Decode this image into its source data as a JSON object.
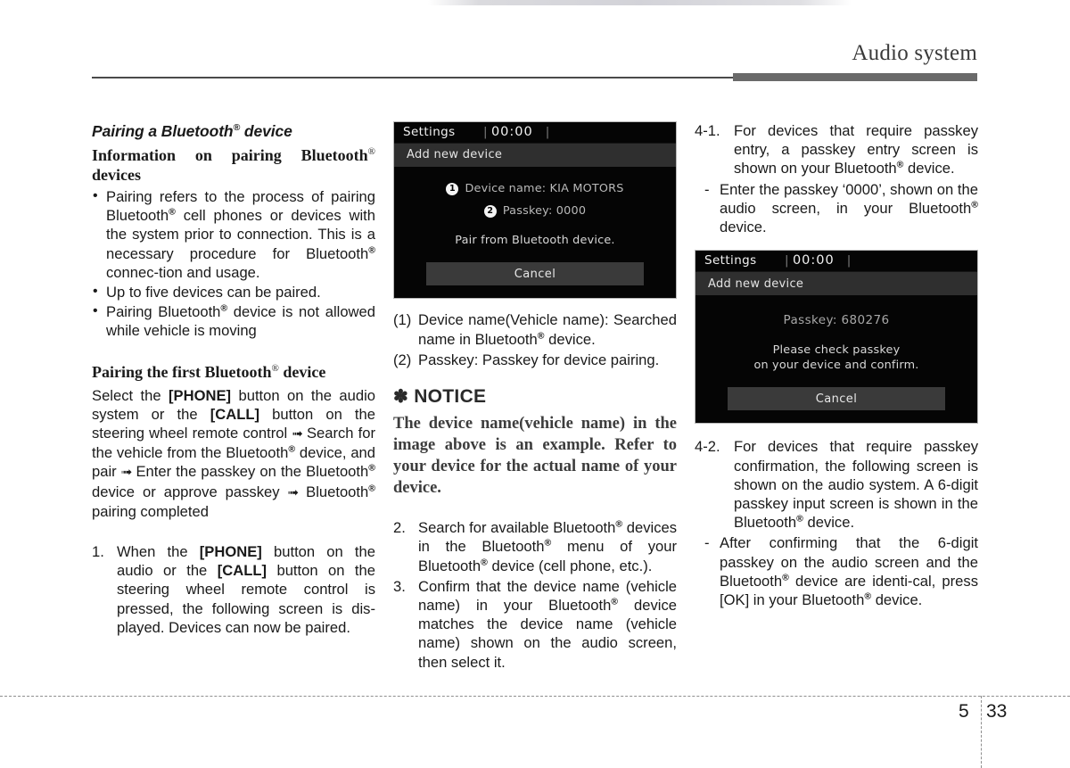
{
  "header": {
    "title": "Audio system"
  },
  "footer": {
    "chapter": "5",
    "page": "33"
  },
  "left_column": {
    "section_title": "Pairing a Bluetooth",
    "section_title_sup": "®",
    "section_title_tail": " device",
    "subhead_1": "Information on pairing Bluetooth",
    "subhead_1_sup": "®",
    "subhead_1_tail": "devices",
    "bullets": [
      {
        "parts": [
          {
            "t": "Pairing refers to the process of pairing Bluetooth"
          },
          {
            "t": "®",
            "sup": true
          },
          {
            "t": " cell phones or devices with the system prior to connection. This is a necessary procedure for Bluetooth"
          },
          {
            "t": "®",
            "sup": true
          },
          {
            "t": " connec-tion and usage."
          }
        ],
        "plain": "Pairing refers to the process of pairing Bluetooth® cell phones or devices with the system prior to connection. This is a necessary procedure for Bluetooth® connection and usage."
      },
      {
        "plain": "Up to five devices can be paired."
      },
      {
        "plain": "Pairing Bluetooth® device is not allowed while vehicle is moving"
      }
    ],
    "bullet_1_a": "Pairing refers to the process of pairing Bluetooth",
    "bullet_1_b": " cell phones or devices with the system prior to connection. This is a necessary procedure for Bluetooth",
    "bullet_1_c": " connec-tion and usage.",
    "bullet_2": "Up to five devices can be paired.",
    "bullet_3_a": "Pairing Bluetooth",
    "bullet_3_b": " device is not allowed while vehicle is moving",
    "subhead_2_a": "Pairing the first Bluetooth",
    "subhead_2_b": " device",
    "para_a": "Select the ",
    "para_phone": "[PHONE]",
    "para_b": " button on the audio system or the ",
    "para_call": "[CALL]",
    "para_c": " button on the steering wheel remote control ",
    "para_d": " Search for the vehicle from the Bluetooth",
    "para_e": " device, and pair ",
    "para_f": " Enter the passkey on the Bluetooth",
    "para_g": " device or approve passkey ",
    "para_h": " Bluetooth",
    "para_i": " pairing completed",
    "step_1_num": "1.",
    "step_1_a": "When the ",
    "step_1_phone": "[PHONE]",
    "step_1_b": " button on the audio or the ",
    "step_1_call": "[CALL]",
    "step_1_c": " button on the steering wheel remote control is pressed, the following screen is dis-played. Devices can now be paired."
  },
  "mid_column": {
    "screen1": {
      "status_label": "Settings",
      "status_clock": "00:00",
      "status_separator": "|",
      "titlebar": "Add new device",
      "badge_1": "1",
      "row_1": "Device name: KIA MOTORS",
      "badge_2": "2",
      "row_2": "Passkey: 0000",
      "message": "Pair from Bluetooth device.",
      "cancel_button": "Cancel"
    },
    "caption_1_num": "(1)",
    "caption_1_a": "Device name(Vehicle name): Searched name in Bluetooth",
    "caption_1_b": "device.",
    "caption_2_num": "(2)",
    "caption_2": "Passkey: Passkey for device pairing.",
    "notice_symbol": "✽",
    "notice_title": "NOTICE",
    "notice_body": "The device name(vehicle name) in the image above is an example. Refer to your device for the actual name of your device.",
    "step_2_num": "2.",
    "step_2_a": "Search for available Bluetooth",
    "step_2_b": " devices in the Bluetooth",
    "step_2_c": " menu of your Bluetooth",
    "step_2_d": " device (cell phone, etc.).",
    "step_3_num": "3.",
    "step_3_a": "Confirm that the device name (vehicle name) in your Bluetooth",
    "step_3_b": " device matches the device name (vehicle name) shown on the audio screen, then select it."
  },
  "right_column": {
    "step_41_num": "4-1.",
    "step_41_a": "For devices that require passkey entry, a passkey entry screen is shown on your Bluetooth",
    "step_41_b": " device.",
    "dash_1_a": "Enter the passkey ‘0000’, shown on the audio screen, in your Bluetooth",
    "dash_1_b": " device.",
    "screen2": {
      "status_label": "Settings",
      "status_clock": "00:00",
      "status_separator": "|",
      "titlebar": "Add new device",
      "passkey": "Passkey: 680276",
      "message_line_1": "Please check passkey",
      "message_line_2": "on your device and confirm.",
      "cancel_button": "Cancel"
    },
    "step_42_num": "4-2.",
    "step_42_a": "For devices that require passkey confirmation, the following screen is shown on the audio system. A 6-digit passkey input screen is shown in the Bluetooth",
    "step_42_b": " device.",
    "dash_2_a": "After confirming that the 6-digit passkey on the audio screen and the Bluetooth",
    "dash_2_b": " device are identi-cal, press [OK] in your Bluetooth",
    "dash_2_c": " device.",
    "reg_mark": "®",
    "arrow_glyph": "➟"
  },
  "colors": {
    "page_background": "#ffffff",
    "text": "#1a1a1a",
    "header_bar": "#6a6a6a",
    "header_rule": "#4a4a4a",
    "screen_background": "#050505",
    "screen_titlebar": "#2f2f2f",
    "screen_button": "#3a3a3a",
    "screen_text": "#cfcfcf",
    "notice_text": "#3d3d3d"
  }
}
